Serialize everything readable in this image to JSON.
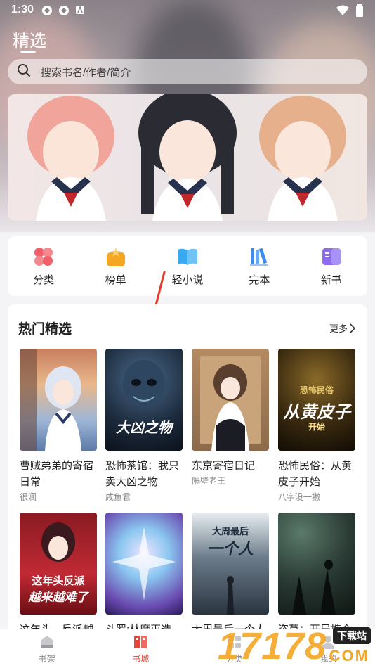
{
  "status_bar": {
    "time": "1:30"
  },
  "header": {
    "title": "精选"
  },
  "search": {
    "placeholder": "搜索书名/作者/简介"
  },
  "quick_nav": [
    {
      "label": "分类",
      "icon": "category-icon",
      "color": "#f0606a"
    },
    {
      "label": "榜单",
      "icon": "ranking-icon",
      "color": "#f5a623"
    },
    {
      "label": "轻小说",
      "icon": "light-novel-icon",
      "color": "#3aa8f0"
    },
    {
      "label": "完本",
      "icon": "finished-books-icon",
      "color": "#3d8cf0"
    },
    {
      "label": "新书",
      "icon": "new-books-icon",
      "color": "#8b6cf0"
    }
  ],
  "hot_section": {
    "title": "热门精选",
    "more_label": "更多"
  },
  "books": [
    {
      "title": "曹贼弟弟的寄宿日常",
      "author": "很润"
    },
    {
      "title": "恐怖茶馆：我只卖大凶之物",
      "author": "咸鱼君",
      "cover_text": "大凶之物"
    },
    {
      "title": "东京寄宿日记",
      "author": "隔壁老王"
    },
    {
      "title": "恐怖民俗：从黄皮子开始",
      "author": "八字没一撇",
      "cover_text_top": "恐怖民俗",
      "cover_text": "从黄皮子",
      "cover_text_sub": "开始"
    },
    {
      "title": "这年头，反派越",
      "author": "",
      "cover_text_top": "这年头反派",
      "cover_text": "越来越难了"
    },
    {
      "title": "斗罗:林魔再造",
      "author": ""
    },
    {
      "title": "大周最后一个人",
      "author": "",
      "cover_text_top": "大周最后",
      "cover_text": "一个人"
    },
    {
      "title": "盗墓：开局携仓",
      "author": ""
    }
  ],
  "bottom_nav": [
    {
      "label": "书架",
      "icon": "bookshelf-icon",
      "active": false
    },
    {
      "label": "书城",
      "icon": "bookstore-icon",
      "active": true
    },
    {
      "label": "分类",
      "icon": "category-nav-icon",
      "active": false
    },
    {
      "label": "我的",
      "icon": "profile-icon",
      "active": false
    }
  ],
  "watermark": {
    "number": "17178",
    "badge": "下载站",
    "domain": "COM"
  },
  "colors": {
    "accent": "#e8453c",
    "watermark": "#f5a623"
  }
}
